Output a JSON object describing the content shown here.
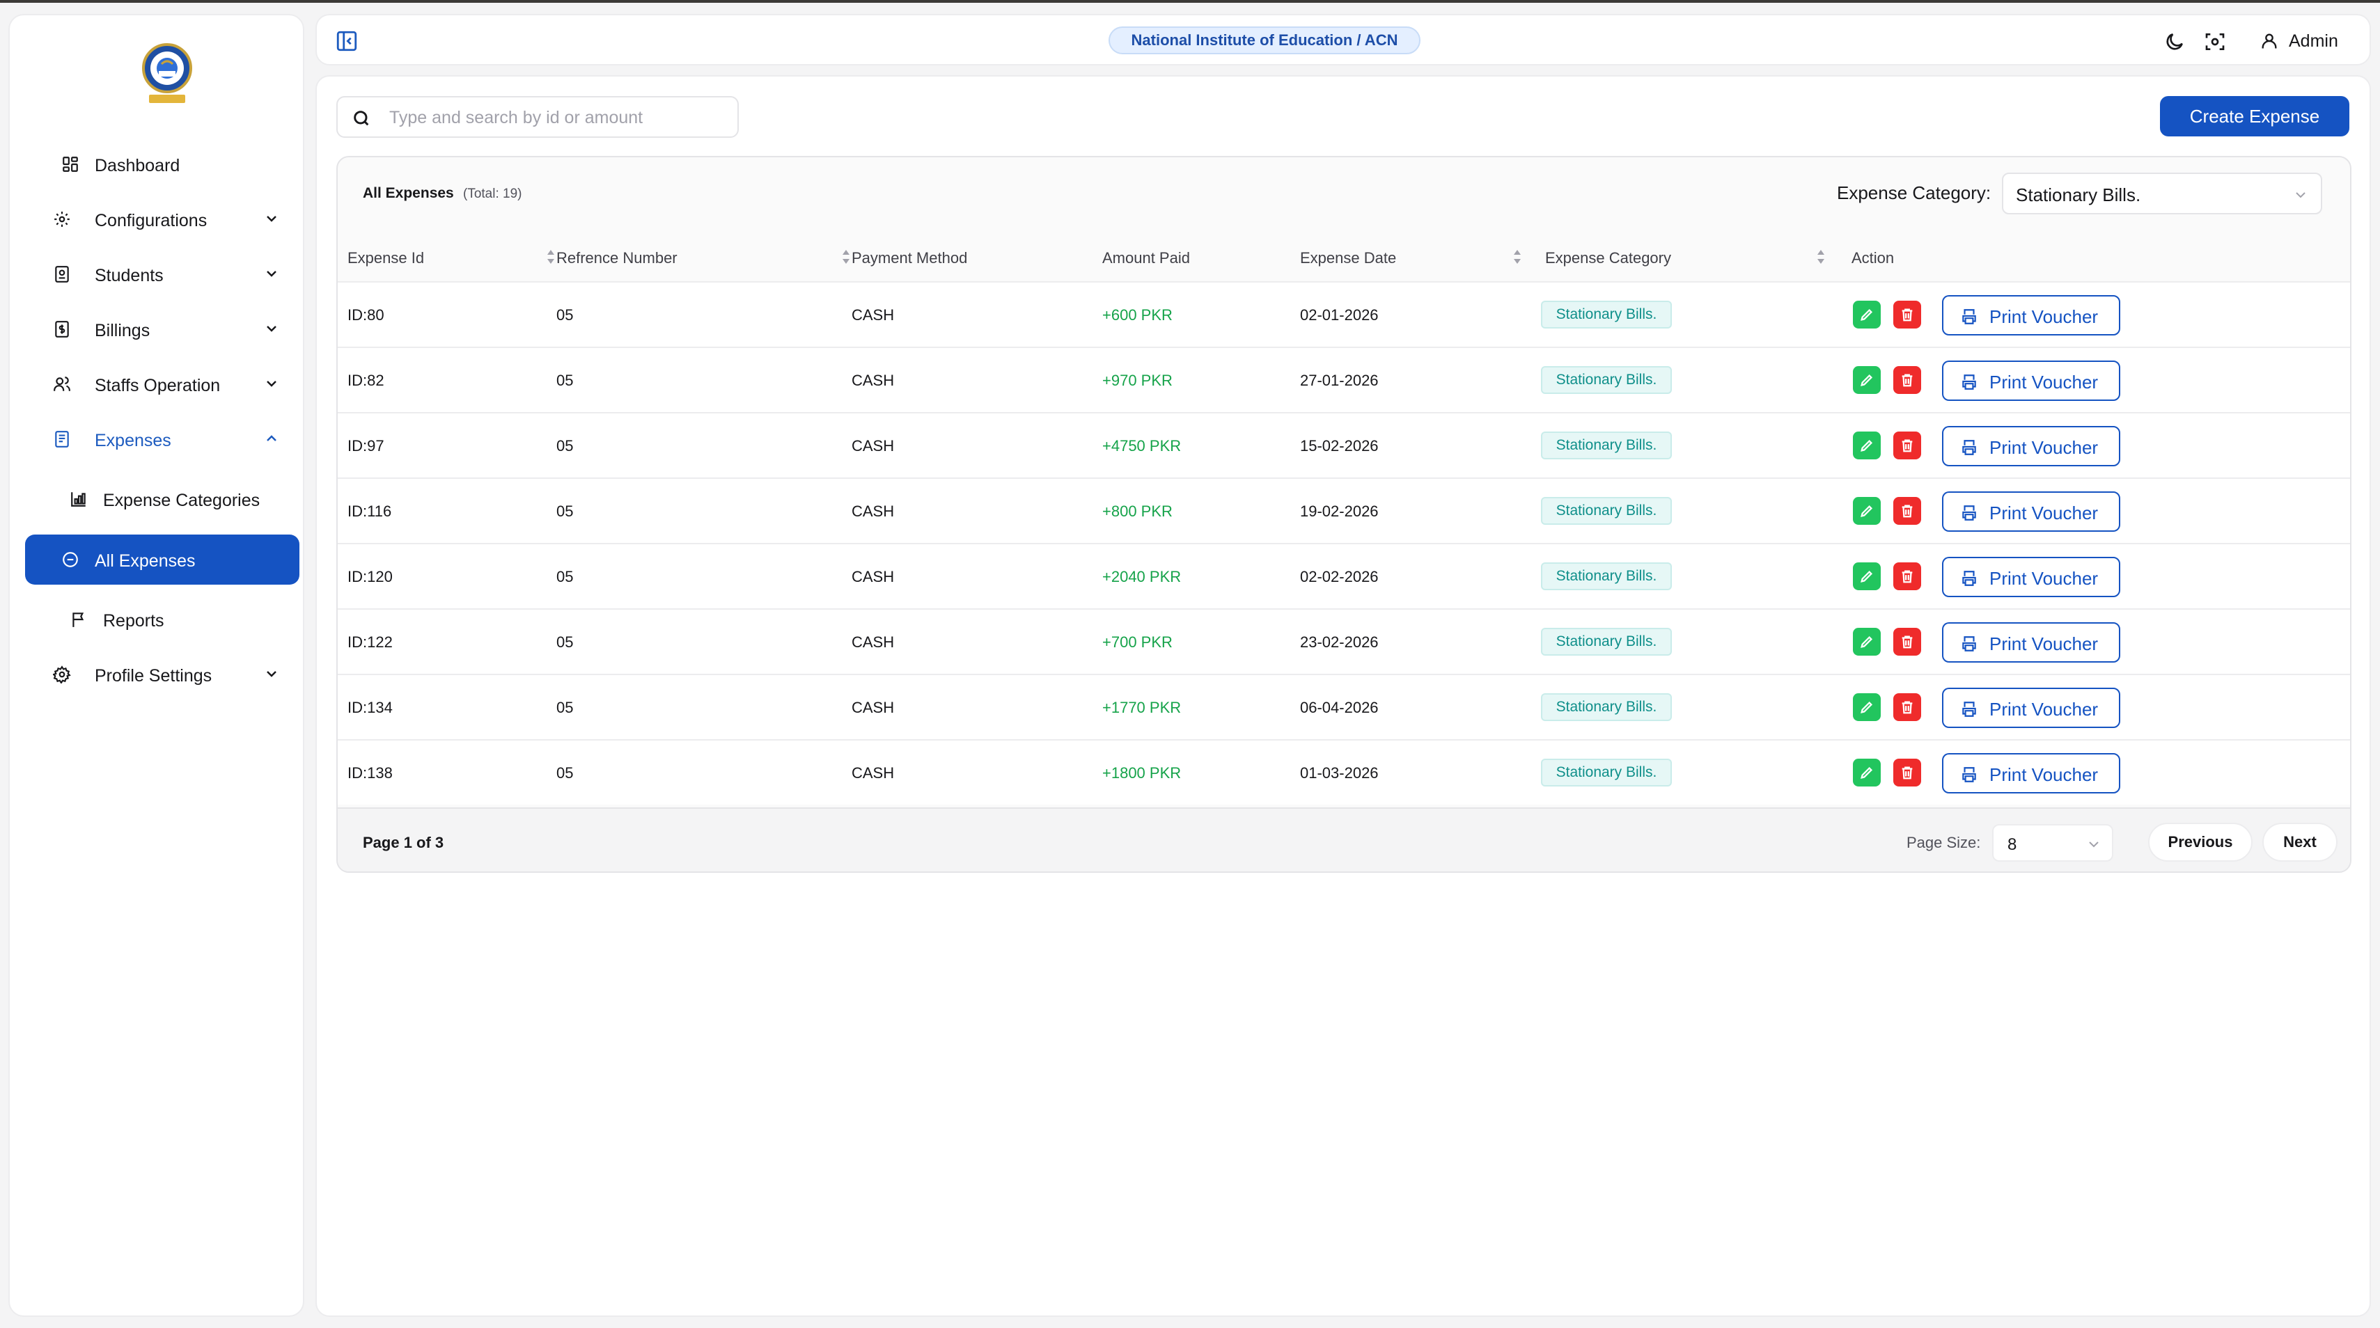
{
  "colors": {
    "primary": "#1553c2",
    "amount_positive": "#16a34a",
    "edit": "#22c55e",
    "delete": "#ef2b2b",
    "badge_text": "#0f8f8a"
  },
  "header": {
    "institute": "National Institute of Education / ACN",
    "user": "Admin",
    "icons": [
      "sidebar-collapse-icon",
      "moon-icon",
      "screenshot-icon",
      "user-icon"
    ]
  },
  "sidebar": {
    "items": [
      {
        "label": "Dashboard",
        "icon": "grid-icon"
      },
      {
        "label": "Configurations",
        "icon": "gear-icon"
      },
      {
        "label": "Students",
        "icon": "id-card-icon"
      },
      {
        "label": "Billings",
        "icon": "dollar-doc-icon"
      },
      {
        "label": "Staffs Operation",
        "icon": "users-icon"
      },
      {
        "label": "Expenses",
        "icon": "receipt-icon"
      },
      {
        "label": "Expense Categories",
        "icon": "chart-icon"
      },
      {
        "label": "All Expenses",
        "icon": "minus-circle-icon"
      },
      {
        "label": "Reports",
        "icon": "flag-icon"
      },
      {
        "label": "Profile Settings",
        "icon": "cog-icon"
      }
    ]
  },
  "toolbar": {
    "search_placeholder": "Type and search by id or amount",
    "search_value": "",
    "create_label": "Create Expense"
  },
  "table": {
    "title": "All Expenses",
    "total": "(Total: 19)",
    "filter_label": "Expense Category:",
    "filter_value": "Stationary Bills.",
    "columns": [
      "Expense Id",
      "Refrence Number",
      "Payment Method",
      "Amount Paid",
      "Expense Date",
      "Expense Category",
      "Action"
    ],
    "print_label": "Print Voucher",
    "rows": [
      {
        "id": "ID:80",
        "ref": "05",
        "method": "CASH",
        "amount": "+600 PKR",
        "date": "02-01-2026",
        "category": "Stationary Bills."
      },
      {
        "id": "ID:82",
        "ref": "05",
        "method": "CASH",
        "amount": "+970 PKR",
        "date": "27-01-2026",
        "category": "Stationary Bills."
      },
      {
        "id": "ID:97",
        "ref": "05",
        "method": "CASH",
        "amount": "+4750 PKR",
        "date": "15-02-2026",
        "category": "Stationary Bills."
      },
      {
        "id": "ID:116",
        "ref": "05",
        "method": "CASH",
        "amount": "+800 PKR",
        "date": "19-02-2026",
        "category": "Stationary Bills."
      },
      {
        "id": "ID:120",
        "ref": "05",
        "method": "CASH",
        "amount": "+2040 PKR",
        "date": "02-02-2026",
        "category": "Stationary Bills."
      },
      {
        "id": "ID:122",
        "ref": "05",
        "method": "CASH",
        "amount": "+700 PKR",
        "date": "23-02-2026",
        "category": "Stationary Bills."
      },
      {
        "id": "ID:134",
        "ref": "05",
        "method": "CASH",
        "amount": "+1770 PKR",
        "date": "06-04-2026",
        "category": "Stationary Bills."
      },
      {
        "id": "ID:138",
        "ref": "05",
        "method": "CASH",
        "amount": "+1800 PKR",
        "date": "01-03-2026",
        "category": "Stationary Bills."
      }
    ]
  },
  "pagination": {
    "page_info": "Page 1 of 3",
    "page_size_label": "Page Size:",
    "page_size": "8",
    "previous": "Previous",
    "next": "Next"
  }
}
